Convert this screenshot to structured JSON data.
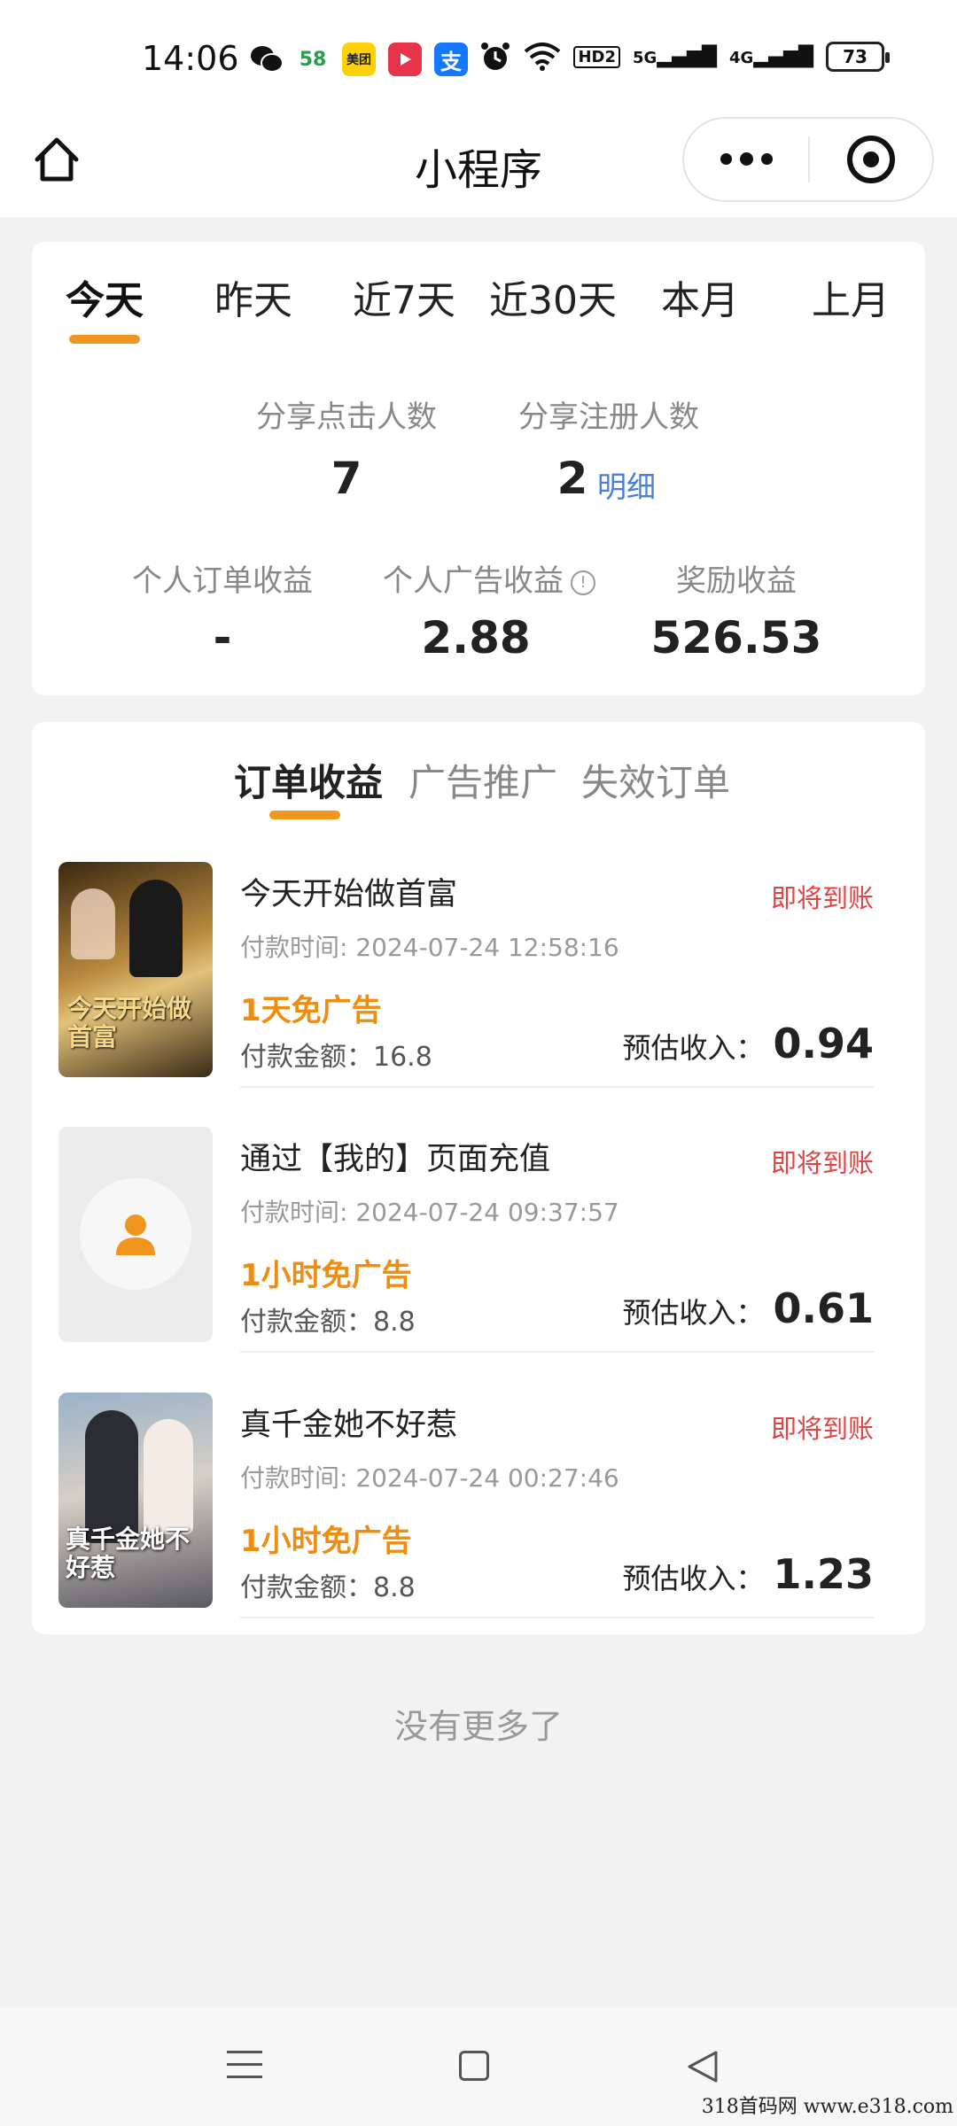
{
  "status_bar": {
    "time": "14:06",
    "apps": [
      {
        "icon": "wechat-icon",
        "label": ""
      },
      {
        "icon": "58-icon",
        "label": "58"
      },
      {
        "icon": "meituan-icon",
        "label": "美团"
      },
      {
        "icon": "video-icon",
        "label": ""
      },
      {
        "icon": "alipay-icon",
        "label": "支"
      }
    ],
    "network": [
      "HD2",
      "5G",
      "4G"
    ],
    "battery": "73"
  },
  "nav": {
    "title": "小程序"
  },
  "period_tabs": [
    "今天",
    "昨天",
    "近7天",
    "近30天",
    "本月",
    "上月"
  ],
  "active_period": "今天",
  "share_stats": {
    "click_label": "分享点击人数",
    "click_value": "7",
    "register_label": "分享注册人数",
    "register_value": "2",
    "detail_link": "明细"
  },
  "income_stats": {
    "order_label": "个人订单收益",
    "order_value": "-",
    "ad_label": "个人广告收益",
    "ad_value": "2.88",
    "reward_label": "奖励收益",
    "reward_value": "526.53"
  },
  "order_tabs": [
    "订单收益",
    "广告推广",
    "失效订单"
  ],
  "orders": [
    {
      "title": "今天开始做首富",
      "status": "即将到账",
      "time": "付款时间: 2024-07-24 12:58:16",
      "tag": "1天免广告",
      "amount": "付款金额：16.8",
      "income_label": "预估收入：",
      "income": "0.94",
      "thumb_text": "今天开始做首富",
      "thumb_colors": [
        "#6b4a1e",
        "#c89a4a",
        "#2b2016"
      ]
    },
    {
      "title": "通过【我的】页面充值",
      "status": "即将到账",
      "time": "付款时间: 2024-07-24 09:37:57",
      "tag": "1小时免广告",
      "amount": "付款金额：8.8",
      "income_label": "预估收入：",
      "income": "0.61",
      "thumb_text": "",
      "thumb_colors": [
        "#e8e8e8",
        "#e8e8e8",
        "#e8e8e8"
      ]
    },
    {
      "title": "真千金她不好惹",
      "status": "即将到账",
      "time": "付款时间: 2024-07-24 00:27:46",
      "tag": "1小时免广告",
      "amount": "付款金额：8.8",
      "income_label": "预估收入：",
      "income": "1.23",
      "thumb_text": "真千金她不好惹",
      "thumb_colors": [
        "#8aa0b8",
        "#d8d2cc",
        "#3a3a44"
      ]
    }
  ],
  "footer": {
    "no_more": "没有更多了"
  },
  "watermark": "318首码网  www.e318.com",
  "colors": {
    "accent": "#f0961e",
    "status": "#e04444",
    "link": "#4a7fd6",
    "tag": "#ee8d10"
  }
}
